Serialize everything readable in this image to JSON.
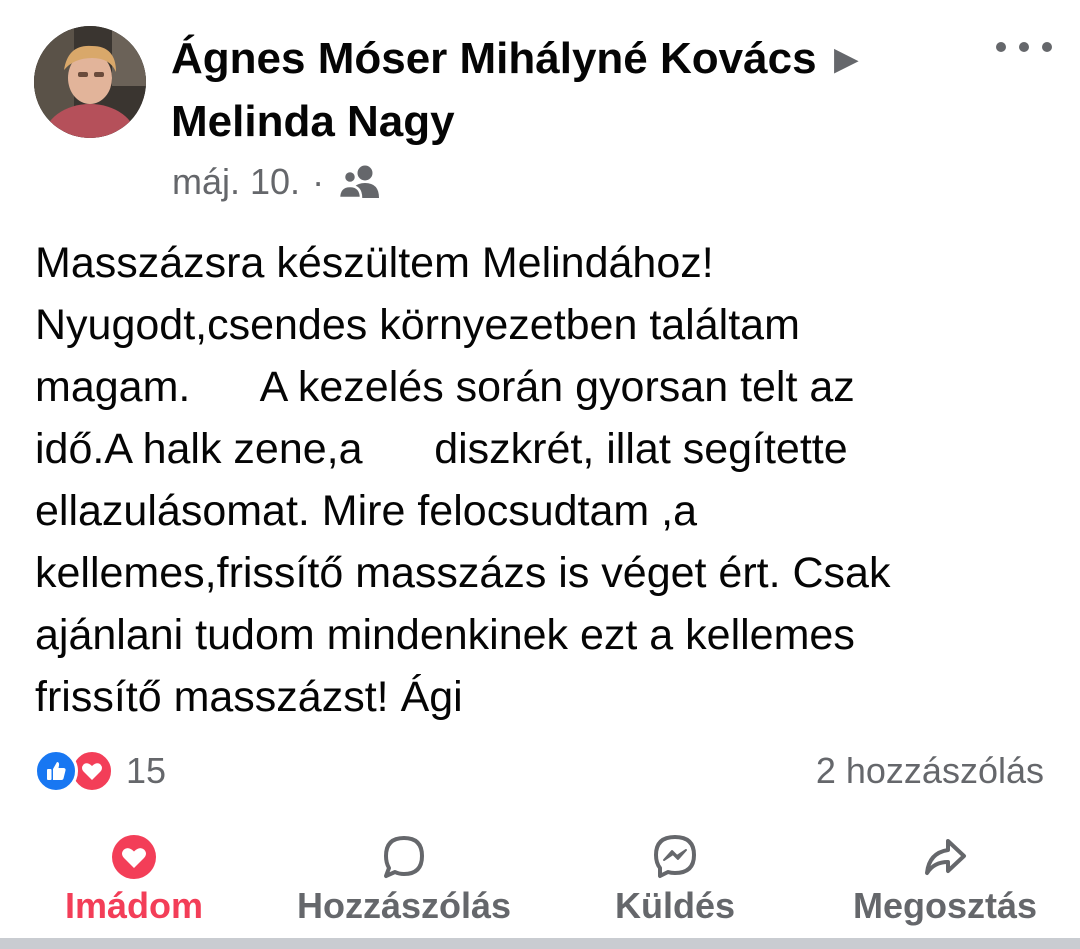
{
  "post": {
    "author": "Ágnes Móser Mihályné Kovács",
    "arrow": "▶",
    "recipient": "Melinda Nagy",
    "date": "máj. 10.",
    "separator": "·",
    "audience_icon": "friends-icon",
    "text": "Masszázsra készültem Melindához!\nNyugodt,csendes környezetben találtam\nmagam.      A kezelés során gyorsan telt az\nidő.A halk zene,a      diszkrét, illat segítette\nellazulásomat. Mire felocsudtam ,a\nkellemes,frissítő masszázs is véget ért. Csak\najánlani tudom mindenkinek ezt a kellemes\nfrissítő masszázst! Ági"
  },
  "reactions": {
    "types": [
      "like-icon",
      "love-icon"
    ],
    "count": "15",
    "comments": "2 hozzászólás"
  },
  "actions": {
    "love": "Imádom",
    "comment": "Hozzászólás",
    "send": "Küldés",
    "share": "Megosztás"
  },
  "colors": {
    "love_active": "#f33e58",
    "like_blue": "#1877f2",
    "secondary_text": "#65676b",
    "primary_text": "#050505"
  }
}
